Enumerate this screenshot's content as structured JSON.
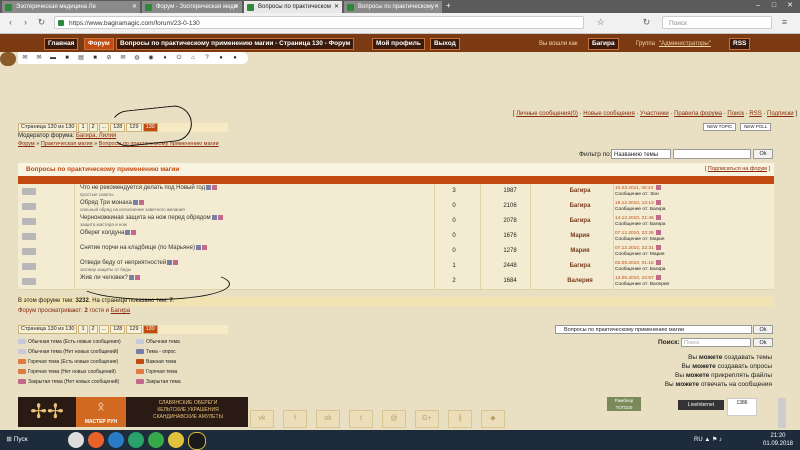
{
  "browser": {
    "tabs": [
      {
        "title": "Эзотерическая медицина Ле"
      },
      {
        "title": "Форум - Эзотерическая меди"
      },
      {
        "title": "Вопросы по практическом"
      },
      {
        "title": "Вопросы по практическому"
      }
    ],
    "url": "https://www.bagiramagic.com/forum/23-0-130",
    "search_placeholder": "Поиск"
  },
  "header": {
    "nav": [
      "Главная",
      "Форум",
      "Вопросы по практическому применению магии - Страница 130 - Форум",
      "Мой профиль",
      "Выход"
    ],
    "greeting": "Вы вошли как",
    "user": "Багира",
    "group_label": "Группа",
    "group": "\"Администраторы\"",
    "rss": "RSS"
  },
  "toplinks": [
    "Личные сообщения(0)",
    "Новые сообщения",
    "Участники",
    "Правила форума",
    "Поиск",
    "RSS",
    "Подписки"
  ],
  "pager": {
    "label": "Страница 130 из 130",
    "pages": [
      "1",
      "2",
      "...",
      "128",
      "129",
      "130"
    ]
  },
  "moderator": {
    "label": "Модератор форума:",
    "names": "Багира, Лилия"
  },
  "breadcrumb": [
    "Форум",
    "Практическая магия",
    "Вопросы по практическому применению магии"
  ],
  "buttons": {
    "new_topic": "NEW TOPIC",
    "new_poll": "NEW POLL",
    "ok": "Ok"
  },
  "filter": {
    "label": "Фильтр по:",
    "value": "Названию темы"
  },
  "forum": {
    "title": "Вопросы по практическому применению магии",
    "subscribe": "Подписаться на форум",
    "topics": [
      {
        "title": "Что не рекомендуется делать под Новый год",
        "desc": "простые советы",
        "replies": "3",
        "views": "1987",
        "author": "Багира",
        "date": "10.03.2011, 08:24",
        "by": "Сообщение от: Эон"
      },
      {
        "title": "Обряд Три монаха",
        "desc": "сильный обряд на исполнение заветного желания",
        "replies": "0",
        "views": "2106",
        "author": "Багира",
        "date": "18.12.2010, 12:13",
        "by": "Сообщение от: Багира"
      },
      {
        "title": "Черноножкиная защита на нож перед обрядом",
        "desc": "защита мастера и нож",
        "replies": "0",
        "views": "2078",
        "author": "Багира",
        "date": "14.12.2010, 21:46",
        "by": "Сообщение от: Багира"
      },
      {
        "title": "Оберег колдуна",
        "desc": "",
        "replies": "0",
        "views": "1676",
        "author": "Мария",
        "date": "07.12.2010, 22:36",
        "by": "Сообщение от: Мария"
      },
      {
        "title": "Снятие порчи на кладбище (по Марьяне)",
        "desc": "",
        "replies": "0",
        "views": "1278",
        "author": "Мария",
        "date": "07.12.2010, 22:31",
        "by": "Сообщение от: Мария"
      },
      {
        "title": "Отведи беду от неприятностей",
        "desc": "заговор защиты от беды",
        "replies": "1",
        "views": "2448",
        "author": "Багира",
        "date": "02.09.2010, 01:16",
        "by": "Сообщение от: Багира"
      },
      {
        "title": "Жив ли человек?",
        "desc": "",
        "replies": "2",
        "views": "1684",
        "author": "Валерия",
        "date": "12.05.2010, 22:57",
        "by": "Сообщение от: Валерия"
      }
    ]
  },
  "stats": {
    "prefix": "В этом форуме тем:",
    "topics": "3232",
    "mid": ". На странице показано тем:",
    "shown": "7",
    "end": "."
  },
  "viewing": {
    "prefix": "Форум просматривают:",
    "count": "2",
    "mid": "гостя и",
    "user": "Багира"
  },
  "jump_select": "Вопросы по практическому применению магии",
  "search_label": "Поиск:",
  "search_placeholder": "Поиск",
  "legend_left": [
    "Обычная тема (Есть новые сообщения)",
    "Обычная тема (Нет новых сообщений)",
    "Горячая тема (Есть новые сообщения)",
    "Горячая тема (Нет новых сообщений)",
    "Закрытая тема (Нет новых сообщений)"
  ],
  "legend_right": [
    "Обычная тема",
    "Тема - опрос",
    "Важная тема",
    "Горячая тема",
    "Закрытая тема"
  ],
  "permissions": [
    {
      "pre": "Вы",
      "bold": "можете",
      "post": "создавать темы"
    },
    {
      "pre": "Вы",
      "bold": "можете",
      "post": "создавать опросы"
    },
    {
      "pre": "Вы",
      "bold": "можете",
      "post": "прикреплять файлы"
    },
    {
      "pre": "Вы",
      "bold": "можете",
      "post": "отвечать на сообщения"
    }
  ],
  "banner": {
    "brand": "МАСТЕР РУН",
    "line1": "СЛАВЯНСКИЕ ОБЕРЕГИ",
    "line2": "КЕЛЬТСКИЕ УКРАШЕНИЯ",
    "line3": "СКАНДИНАВСКИЕ АМУЛЕТЫ"
  },
  "counters": {
    "rambler": "Рамблер ТОП100",
    "liveinternet": "LiveInternet",
    "ya": "1386"
  },
  "taskbar": {
    "start": "Пуск",
    "lang": "RU",
    "time": "21:20",
    "date": "01.09.2018"
  }
}
